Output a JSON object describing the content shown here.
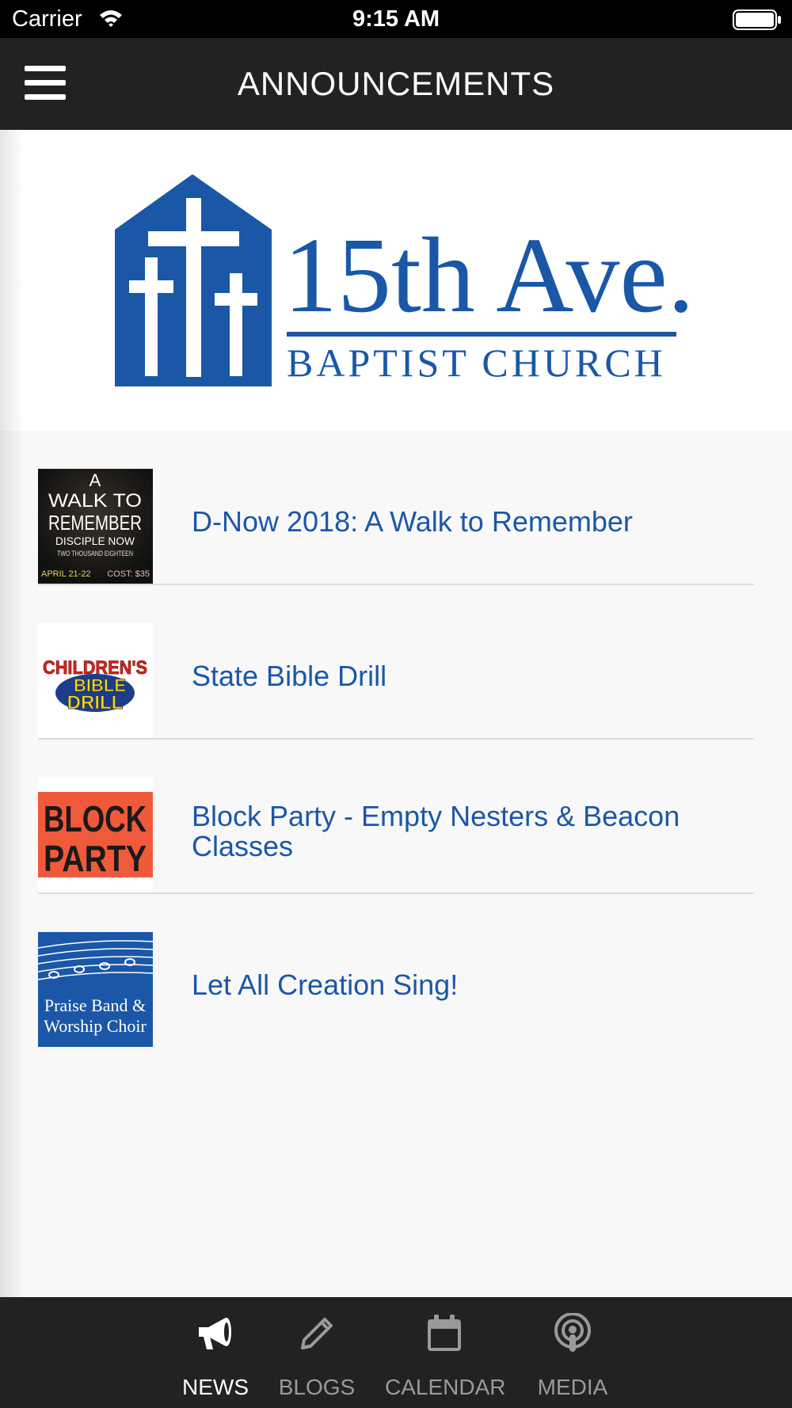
{
  "status_bar": {
    "carrier": "Carrier",
    "time": "9:15 AM"
  },
  "header": {
    "title": "ANNOUNCEMENTS"
  },
  "logo": {
    "line1": "15th Ave.",
    "line2": "BAPTIST CHURCH",
    "color": "#1b57a7"
  },
  "announcements": [
    {
      "title": "D-Now 2018: A Walk to Remember",
      "thumb": {
        "line1": "A",
        "line2": "WALK TO",
        "line3": "REMEMBER",
        "line4": "DISCIPLE NOW",
        "line5": "TWO THOUSAND EIGHTEEN",
        "date": "APRIL 21-22",
        "cost": "COST: $35"
      }
    },
    {
      "title": "State Bible Drill",
      "thumb": {
        "line1": "CHILDREN'S",
        "line2": "BIBLE",
        "line3": "DRILL"
      }
    },
    {
      "title": "Block Party - Empty Nesters & Beacon Classes",
      "thumb": {
        "line1": "BLOCK",
        "line2": "PARTY"
      }
    },
    {
      "title": "Let All Creation Sing!",
      "thumb": {
        "line1": "Praise Band &",
        "line2": "Worship Choir"
      }
    }
  ],
  "tabs": [
    {
      "label": "NEWS",
      "icon": "megaphone-icon",
      "active": true
    },
    {
      "label": "BLOGS",
      "icon": "pencil-icon",
      "active": false
    },
    {
      "label": "CALENDAR",
      "icon": "calendar-icon",
      "active": false
    },
    {
      "label": "MEDIA",
      "icon": "podcast-icon",
      "active": false
    }
  ]
}
